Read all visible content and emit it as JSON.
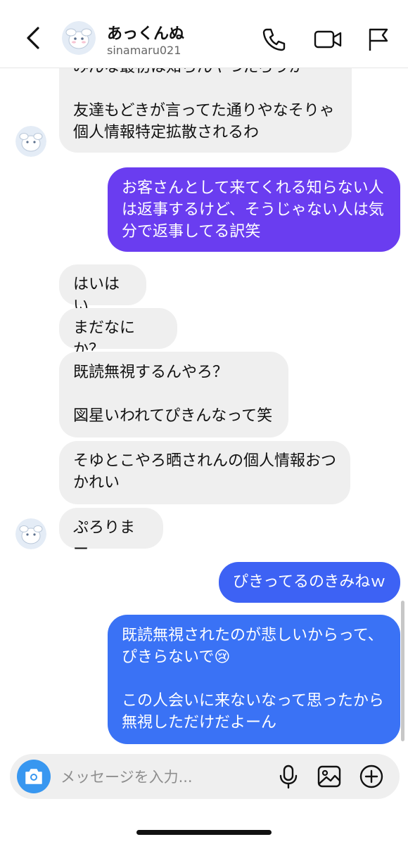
{
  "header": {
    "name": "あっくんぬ",
    "username": "sinamaru021"
  },
  "messages": [
    {
      "side": "in",
      "text": "みんな最初は知らんやつだろうが\n\n友達もどきが言ってた通りやなそりゃ\n個人情報特定拡散されるわ"
    },
    {
      "side": "out",
      "text": "お客さんとして来てくれる知らない人\nは返事するけど、そうじゃない人は気\n分で返事してる訳笑"
    },
    {
      "side": "in",
      "text": "はいはい"
    },
    {
      "side": "in",
      "text": "まだなにか？"
    },
    {
      "side": "in",
      "text": "既読無視するんやろ？\n\n図星いわれてぴきんなって笑"
    },
    {
      "side": "in",
      "text": "そゆとこやろ晒されんの個人情報おつ\nかれい"
    },
    {
      "side": "in",
      "text": "ぷろりまー"
    },
    {
      "side": "out",
      "text": "ぴきってるのきみねｗ"
    },
    {
      "side": "out",
      "text": "既読無視されたのが悲しいからって、\nぴきらないで😢\n\nこの人会いに来ないなって思ったから\n無視しただけだよーん"
    }
  ],
  "composer": {
    "placeholder": "メッセージを入力..."
  },
  "colors": {
    "outgoing_purple": "#6a3df0",
    "outgoing_blue": "#3a72f5",
    "incoming": "#efefef",
    "camera_button": "#3897f0"
  },
  "icons": [
    "back-arrow-icon",
    "phone-icon",
    "video-camera-icon",
    "flag-icon",
    "camera-icon",
    "microphone-icon",
    "image-icon",
    "plus-circle-icon"
  ]
}
